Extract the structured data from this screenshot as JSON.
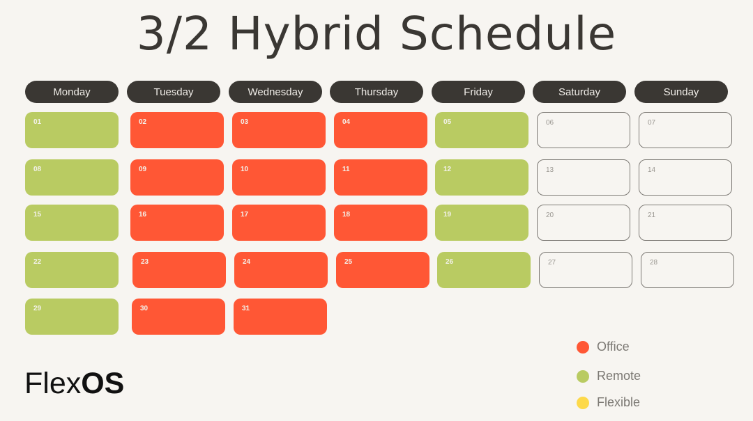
{
  "title": "3/2 Hybrid Schedule",
  "days": [
    "Monday",
    "Tuesday",
    "Wednesday",
    "Thursday",
    "Friday",
    "Saturday",
    "Sunday"
  ],
  "weeks": [
    [
      {
        "d": "01",
        "t": "remote"
      },
      {
        "d": "02",
        "t": "office"
      },
      {
        "d": "03",
        "t": "office"
      },
      {
        "d": "04",
        "t": "office"
      },
      {
        "d": "05",
        "t": "remote"
      },
      {
        "d": "06",
        "t": "empty"
      },
      {
        "d": "07",
        "t": "empty"
      }
    ],
    [
      {
        "d": "08",
        "t": "remote"
      },
      {
        "d": "09",
        "t": "office"
      },
      {
        "d": "10",
        "t": "office"
      },
      {
        "d": "11",
        "t": "office"
      },
      {
        "d": "12",
        "t": "remote"
      },
      {
        "d": "13",
        "t": "empty"
      },
      {
        "d": "14",
        "t": "empty"
      }
    ],
    [
      {
        "d": "15",
        "t": "remote"
      },
      {
        "d": "16",
        "t": "office"
      },
      {
        "d": "17",
        "t": "office"
      },
      {
        "d": "18",
        "t": "office"
      },
      {
        "d": "19",
        "t": "remote"
      },
      {
        "d": "20",
        "t": "empty"
      },
      {
        "d": "21",
        "t": "empty"
      }
    ],
    [
      {
        "d": "22",
        "t": "remote"
      },
      {
        "d": "23",
        "t": "office"
      },
      {
        "d": "24",
        "t": "office"
      },
      {
        "d": "25",
        "t": "office"
      },
      {
        "d": "26",
        "t": "remote"
      },
      {
        "d": "27",
        "t": "empty"
      },
      {
        "d": "28",
        "t": "empty"
      }
    ],
    [
      {
        "d": "29",
        "t": "remote"
      },
      {
        "d": "30",
        "t": "office"
      },
      {
        "d": "31",
        "t": "office"
      }
    ]
  ],
  "logo": {
    "light": "Flex",
    "bold": "OS"
  },
  "legend": [
    {
      "label": "Office",
      "color": "#ff5735"
    },
    {
      "label": "Remote",
      "color": "#b9cb62"
    },
    {
      "label": "Flexible",
      "color": "#fdd94a"
    }
  ]
}
